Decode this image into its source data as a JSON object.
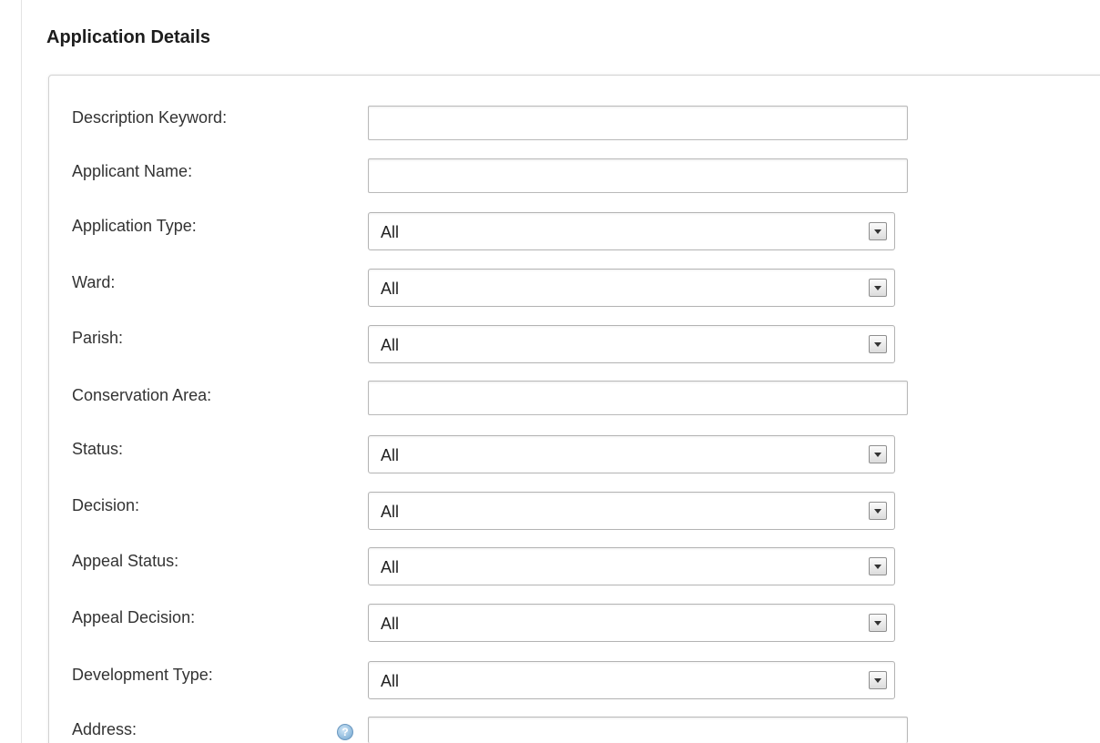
{
  "section": {
    "title": "Application Details"
  },
  "form": {
    "description_keyword": {
      "label": "Description Keyword:",
      "value": ""
    },
    "applicant_name": {
      "label": "Applicant Name:",
      "value": ""
    },
    "application_type": {
      "label": "Application Type:",
      "value": "All"
    },
    "ward": {
      "label": "Ward:",
      "value": "All"
    },
    "parish": {
      "label": "Parish:",
      "value": "All"
    },
    "conservation_area": {
      "label": "Conservation Area:",
      "value": ""
    },
    "status": {
      "label": "Status:",
      "value": "All"
    },
    "decision": {
      "label": "Decision:",
      "value": "All"
    },
    "appeal_status": {
      "label": "Appeal Status:",
      "value": "All"
    },
    "appeal_decision": {
      "label": "Appeal Decision:",
      "value": "All"
    },
    "development_type": {
      "label": "Development Type:",
      "value": "All"
    },
    "address": {
      "label": "Address:",
      "value": "",
      "help_icon": "help-icon"
    }
  },
  "colors": {
    "panel_border": "#d2d2d2",
    "label_text": "#333333",
    "help_icon": "#6fa4cf"
  }
}
